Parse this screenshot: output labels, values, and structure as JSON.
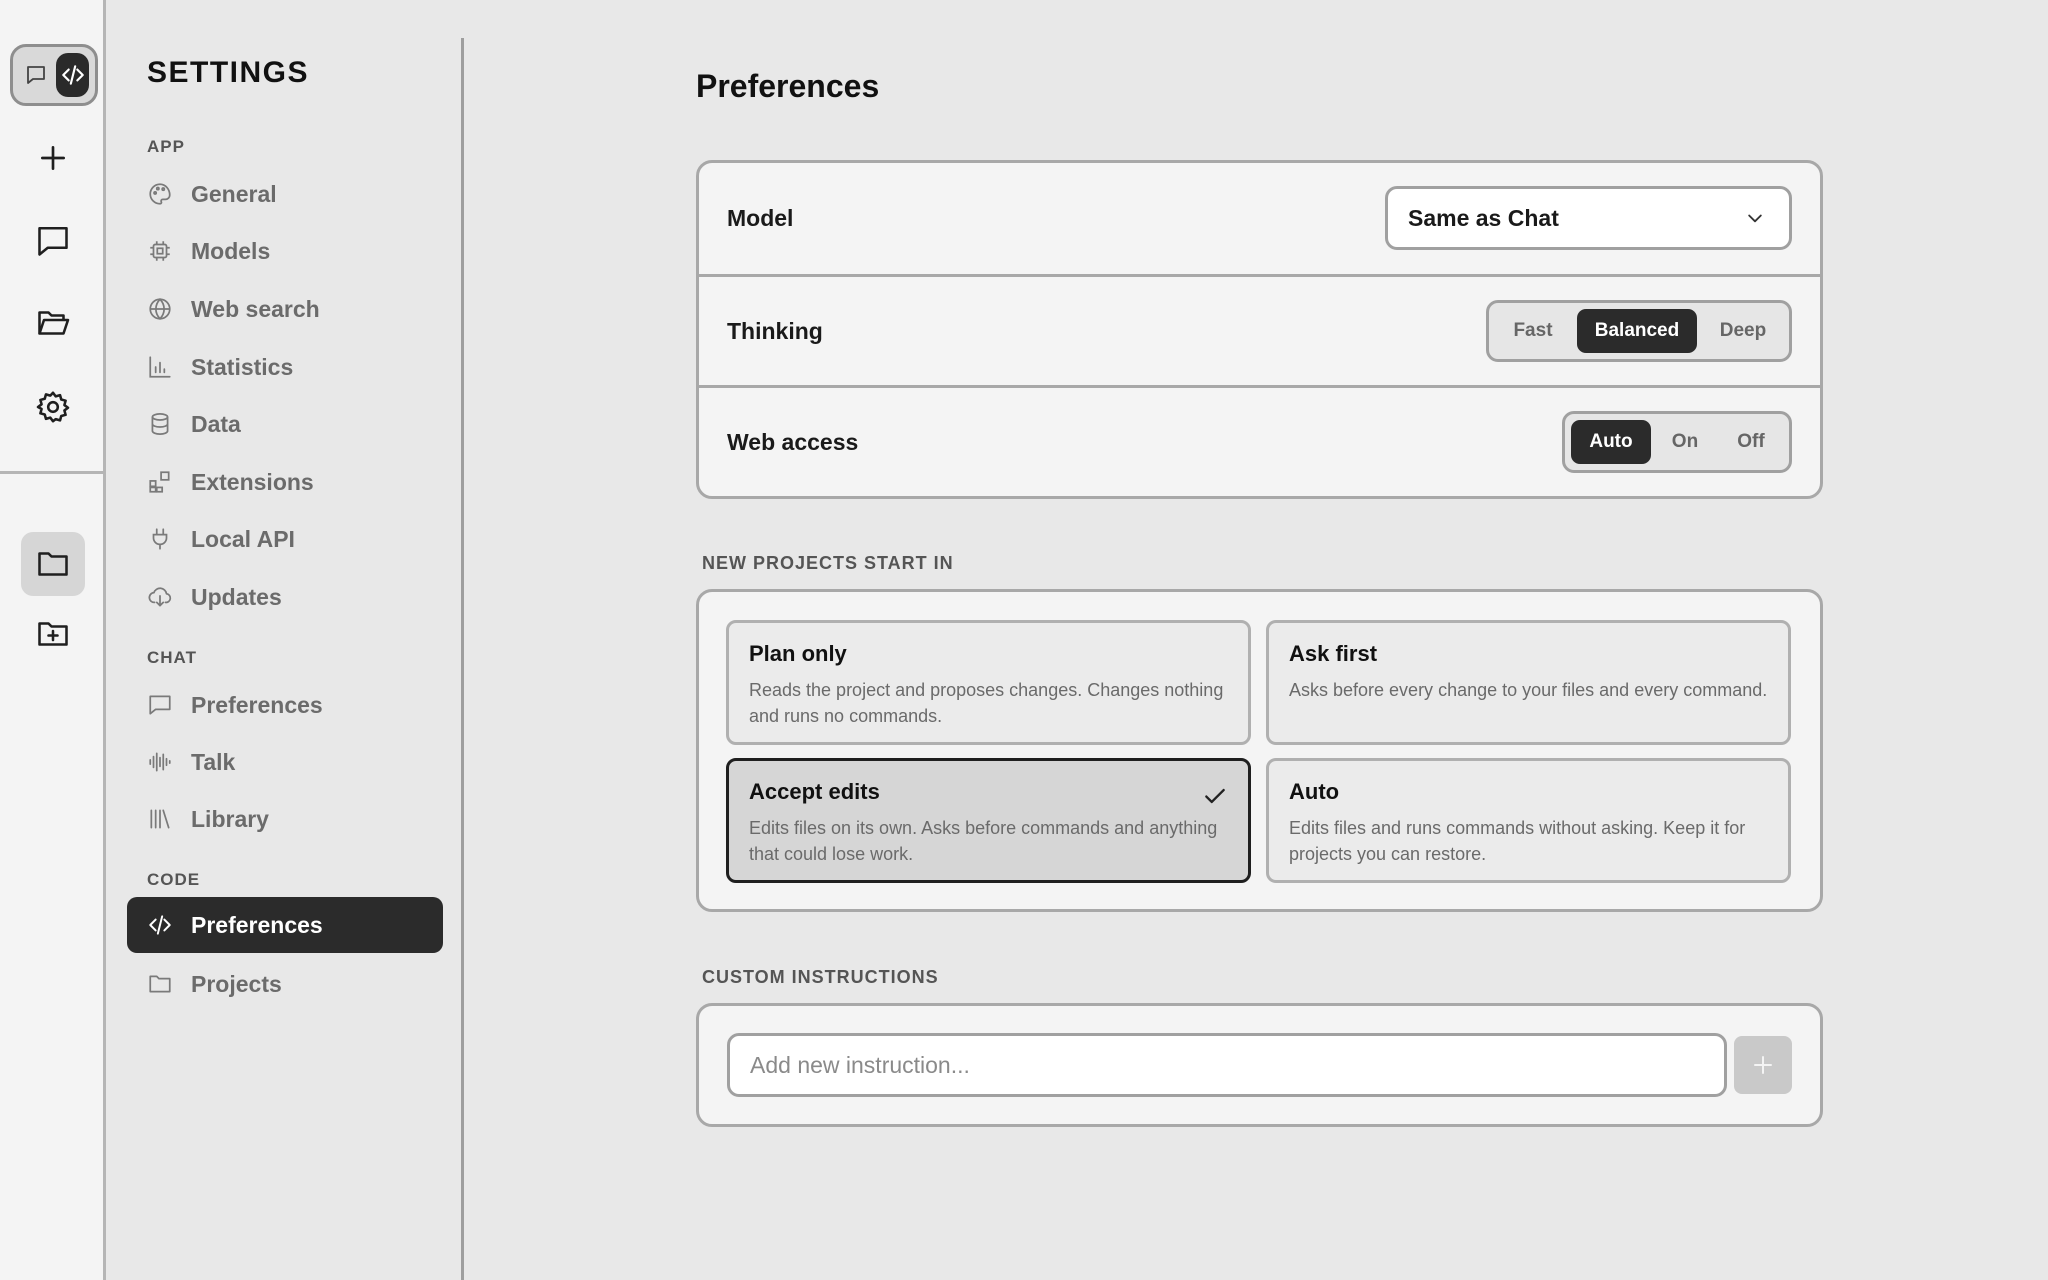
{
  "rail": {
    "mode_toggle": {
      "chat_icon": "chat-bubble-icon",
      "code_icon": "code-icon",
      "active": "code"
    },
    "buttons": [
      {
        "name": "new-chat-button",
        "icon": "plus-icon"
      },
      {
        "name": "chats-button",
        "icon": "chat-bubble-icon"
      },
      {
        "name": "open-folder-button",
        "icon": "folder-open-icon"
      },
      {
        "name": "settings-button",
        "icon": "gear-icon"
      }
    ],
    "lower_buttons": [
      {
        "name": "projects-button",
        "icon": "folder-icon",
        "active": true
      },
      {
        "name": "new-project-button",
        "icon": "folder-plus-icon"
      }
    ]
  },
  "sidebar": {
    "title": "SETTINGS",
    "sections": [
      {
        "label": "APP",
        "items": [
          {
            "label": "General",
            "icon": "palette-icon"
          },
          {
            "label": "Models",
            "icon": "chip-icon"
          },
          {
            "label": "Web search",
            "icon": "globe-icon"
          },
          {
            "label": "Statistics",
            "icon": "bar-chart-icon"
          },
          {
            "label": "Data",
            "icon": "database-icon"
          },
          {
            "label": "Extensions",
            "icon": "extensions-icon"
          },
          {
            "label": "Local API",
            "icon": "plug-icon"
          },
          {
            "label": "Updates",
            "icon": "cloud-download-icon"
          }
        ]
      },
      {
        "label": "CHAT",
        "items": [
          {
            "label": "Preferences",
            "icon": "chat-bubble-icon"
          },
          {
            "label": "Talk",
            "icon": "audio-wave-icon"
          },
          {
            "label": "Library",
            "icon": "library-icon"
          }
        ]
      },
      {
        "label": "CODE",
        "items": [
          {
            "label": "Preferences",
            "icon": "code-icon",
            "active": true
          },
          {
            "label": "Projects",
            "icon": "folder-icon"
          }
        ]
      }
    ]
  },
  "main": {
    "title": "Preferences",
    "settings": {
      "model": {
        "label": "Model",
        "value": "Same as Chat"
      },
      "thinking": {
        "label": "Thinking",
        "options": [
          "Fast",
          "Balanced",
          "Deep"
        ],
        "selected": "Balanced"
      },
      "web_access": {
        "label": "Web access",
        "options": [
          "Auto",
          "On",
          "Off"
        ],
        "selected": "Auto"
      }
    },
    "new_projects": {
      "label": "NEW PROJECTS START IN",
      "modes": [
        {
          "title": "Plan only",
          "desc": "Reads the project and proposes changes. Changes nothing and runs no commands.",
          "selected": false
        },
        {
          "title": "Ask first",
          "desc": "Asks before every change to your files and every command.",
          "selected": false
        },
        {
          "title": "Accept edits",
          "desc": "Edits files on its own. Asks before commands and anything that could lose work.",
          "selected": true
        },
        {
          "title": "Auto",
          "desc": "Edits files and runs commands without asking. Keep it for projects you can restore.",
          "selected": false
        }
      ]
    },
    "custom_instructions": {
      "label": "CUSTOM INSTRUCTIONS",
      "placeholder": "Add new instruction...",
      "value": ""
    }
  }
}
